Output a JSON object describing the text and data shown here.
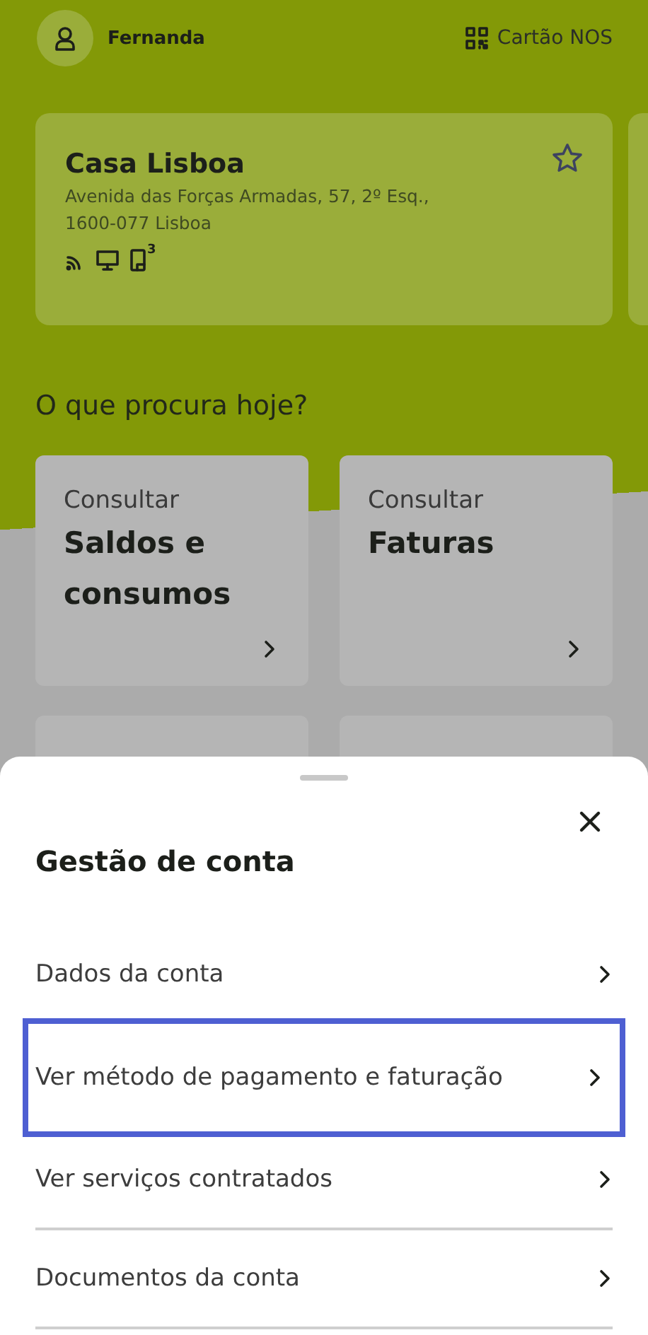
{
  "header": {
    "user_name": "Fernanda",
    "card_link": "Cartão NOS"
  },
  "account_card": {
    "title": "Casa Lisboa",
    "address": "Avenida das Forças Armadas, 57, 2º Esq., 1600-077 Lisboa",
    "favorite": false,
    "services": [
      {
        "kind": "internet"
      },
      {
        "kind": "tv"
      },
      {
        "kind": "mobile",
        "count": "3"
      }
    ]
  },
  "question": "O que procura hoje?",
  "tiles": [
    {
      "label": "Consultar",
      "title": "Saldos e consumos"
    },
    {
      "label": "Consultar",
      "title": "Faturas"
    }
  ],
  "sheet": {
    "title": "Gestão de conta",
    "items": [
      {
        "label": "Dados da conta",
        "selected": false,
        "divider": false
      },
      {
        "label": "Ver método de pagamento e faturação",
        "selected": true,
        "divider": false
      },
      {
        "label": "Ver serviços contratados",
        "selected": false,
        "divider": true
      },
      {
        "label": "Documentos da conta",
        "selected": false,
        "divider": true
      }
    ]
  }
}
